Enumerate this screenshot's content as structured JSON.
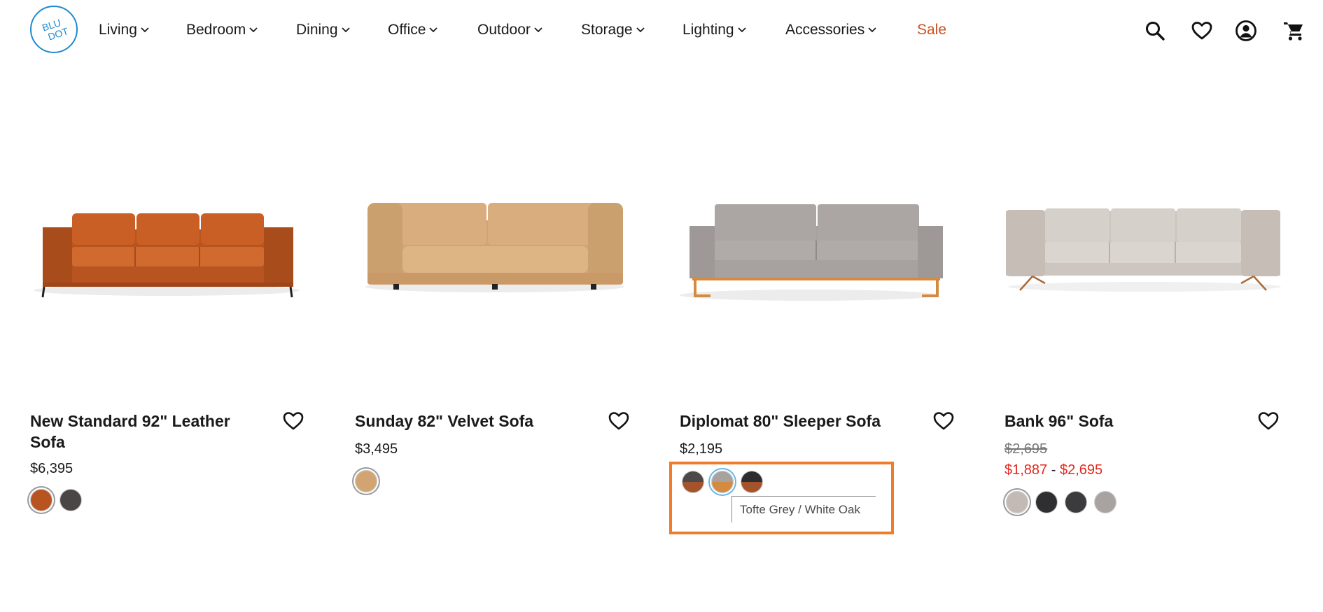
{
  "brand": {
    "name": "BLU DOT",
    "line1": "BLU",
    "line2": "DOT",
    "color": "#1e8ad0"
  },
  "nav": {
    "items": [
      {
        "label": "Living",
        "has_dropdown": true
      },
      {
        "label": "Bedroom",
        "has_dropdown": true
      },
      {
        "label": "Dining",
        "has_dropdown": true
      },
      {
        "label": "Office",
        "has_dropdown": true
      },
      {
        "label": "Outdoor",
        "has_dropdown": true
      },
      {
        "label": "Storage",
        "has_dropdown": true
      },
      {
        "label": "Lighting",
        "has_dropdown": true
      },
      {
        "label": "Accessories",
        "has_dropdown": true
      },
      {
        "label": "Sale",
        "has_dropdown": false,
        "color": "#c9531f"
      }
    ]
  },
  "header_icons": [
    "search-icon",
    "heart-icon",
    "account-icon",
    "cart-icon"
  ],
  "products": [
    {
      "title": "New Standard 92\" Leather Sofa",
      "price": "$6,395",
      "swatches": [
        {
          "colors": [
            "#b8541f",
            "#b8541f"
          ],
          "selected": true
        },
        {
          "colors": [
            "#4a4645",
            "#4a4645"
          ],
          "selected": false
        }
      ]
    },
    {
      "title": "Sunday 82\" Velvet Sofa",
      "price": "$3,495",
      "swatches": [
        {
          "colors": [
            "#d2a472",
            "#d2a472"
          ],
          "selected": true
        }
      ]
    },
    {
      "title": "Diplomat 80\" Sleeper Sofa",
      "price": "$2,195",
      "swatches": [
        {
          "colors": [
            "#4c4a48",
            "#a4532a"
          ],
          "selected": false
        },
        {
          "colors": [
            "#a7a2a0",
            "#d58a42"
          ],
          "selected": false,
          "focused": true
        },
        {
          "colors": [
            "#2d2c2e",
            "#a4532a"
          ],
          "selected": false
        }
      ],
      "tooltip": "Tofte Grey / White Oak"
    },
    {
      "title": "Bank 96\" Sofa",
      "price_original": "$2,695",
      "price_sale_low": "$1,887",
      "price_sale_sep": "-",
      "price_sale_high": "$2,695",
      "swatches": [
        {
          "colors": [
            "#c3bab3",
            "#c3bab3"
          ],
          "selected": true
        },
        {
          "colors": [
            "#2f2e30",
            "#2f2e30"
          ],
          "selected": false
        },
        {
          "colors": [
            "#3b3a3c",
            "#3b3a3c"
          ],
          "selected": false
        },
        {
          "colors": [
            "#a8a2a1",
            "#a8a2a1"
          ],
          "selected": false
        }
      ]
    }
  ],
  "colors": {
    "highlight": "#f07b2a",
    "sale_price": "#e3271d",
    "focus_ring": "#66b8e8"
  }
}
